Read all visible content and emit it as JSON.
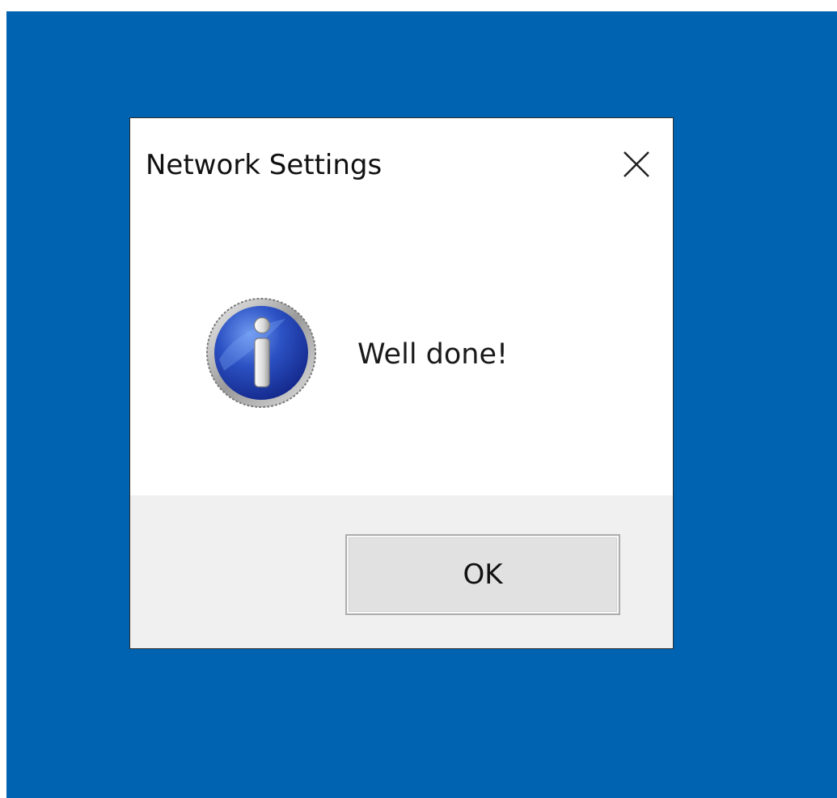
{
  "window": {
    "title": "Network Settings",
    "close_icon": "close-icon"
  },
  "message": {
    "icon": "info-icon",
    "text": "Well done!"
  },
  "footer": {
    "ok_label": "OK"
  },
  "colors": {
    "desktop": "#0063b1",
    "dialog_background": "#ffffff",
    "footer_background": "#f0f0f0",
    "icon_blue": "#1e3ea6"
  }
}
